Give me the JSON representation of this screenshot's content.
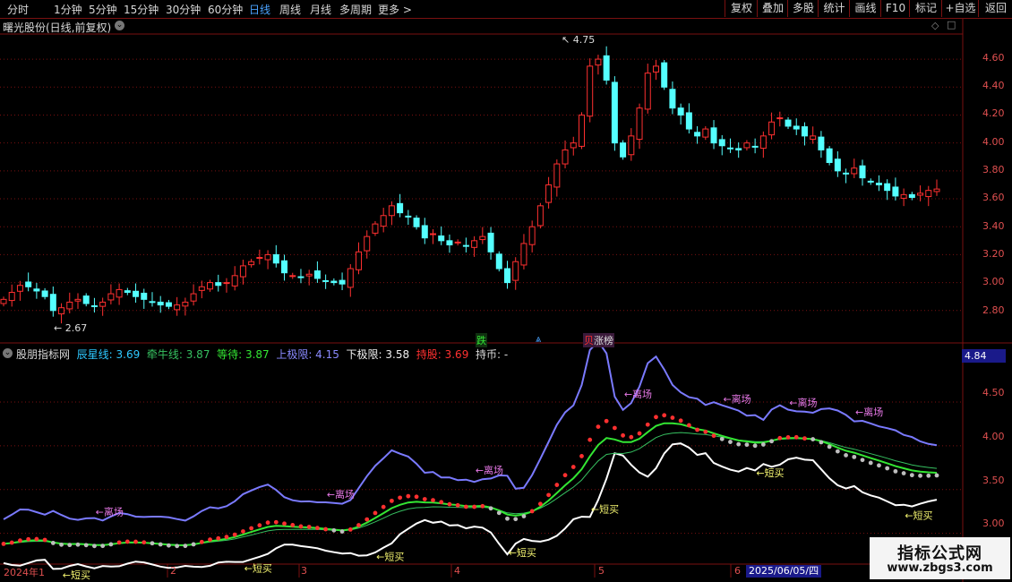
{
  "toolbar": {
    "periods": [
      "分时",
      "1分钟",
      "5分钟",
      "15分钟",
      "30分钟",
      "60分钟",
      "日线",
      "周线",
      "月线",
      "多周期",
      "更多 >"
    ],
    "active_period": "日线",
    "right_buttons": [
      "复权",
      "叠加",
      "多股",
      "统计",
      "画线",
      "F10",
      "标记",
      "+自选",
      "返回"
    ]
  },
  "stock": {
    "title": "曙光股份(日线,前复权)",
    "high_label": "4.75",
    "low_label": "2.67",
    "price_axis": [
      "4.60",
      "4.40",
      "4.20",
      "4.00",
      "3.80",
      "3.60",
      "3.40",
      "3.20",
      "3.00",
      "2.80"
    ]
  },
  "markers": {
    "m1": "跌",
    "m2": "涨榜"
  },
  "indicator": {
    "name": "股朋指标网",
    "items": [
      {
        "label": "辰星线: 3.69",
        "color": "#2ec8ff"
      },
      {
        "label": "牵牛线: 3.87",
        "color": "#36c060"
      },
      {
        "label": "等待: 3.87",
        "color": "#33e633"
      },
      {
        "label": "上极限: 4.15",
        "color": "#8a8aff"
      },
      {
        "label": "下极限: 3.58",
        "color": "#f0f0f0"
      },
      {
        "label": "持股: 3.69",
        "color": "#ff3030"
      },
      {
        "label": "持币: -",
        "color": "#d8d8d8"
      }
    ],
    "axis": [
      "4.50",
      "4.00",
      "3.50",
      "3.00"
    ],
    "axis_box": "4.84",
    "sell_label": "←离场",
    "buy_label": "←短买",
    "sell_label_short": "离场",
    "buy_label_short": "短买"
  },
  "dates": {
    "labels": [
      "2024年1",
      "2",
      "3",
      "4",
      "5",
      "6"
    ],
    "current": "2025/06/05/四"
  },
  "watermark": {
    "title": "指标公式网",
    "url": "www.zbgs3.com"
  },
  "colors": {
    "up": "#ff3030",
    "down": "#54ffff",
    "upper": "#7a7aff",
    "lower": "#ffffff",
    "wait": "#33e633",
    "slow": "#36c060",
    "grid": "#7a1010"
  },
  "chart_data": {
    "type": "candlestick",
    "ylim": [
      2.6,
      4.78
    ],
    "indicator_ylim": [
      2.7,
      4.95
    ],
    "price_axis_ticks": [
      4.6,
      4.4,
      4.2,
      4.0,
      3.8,
      3.6,
      3.4,
      3.2,
      3.0,
      2.8
    ],
    "indicator_axis_ticks": [
      4.5,
      4.0,
      3.5,
      3.0
    ],
    "high": 4.75,
    "low": 2.67,
    "indicator_last": {
      "辰星线": 3.69,
      "牵牛线": 3.87,
      "等待": 3.87,
      "上极限": 4.15,
      "下极限": 3.58,
      "持股": 3.69
    },
    "close_series": [
      2.88,
      2.93,
      2.98,
      2.97,
      2.94,
      2.9,
      2.8,
      2.82,
      2.86,
      2.88,
      2.85,
      2.83,
      2.86,
      2.92,
      2.95,
      2.93,
      2.9,
      2.88,
      2.86,
      2.84,
      2.83,
      2.84,
      2.86,
      2.92,
      2.97,
      3.0,
      2.98,
      3.0,
      3.05,
      3.12,
      3.15,
      3.18,
      3.2,
      3.14,
      3.07,
      3.05,
      3.04,
      3.06,
      3.03,
      3.01,
      3.0,
      2.99,
      3.1,
      3.22,
      3.33,
      3.42,
      3.48,
      3.55,
      3.5,
      3.47,
      3.4,
      3.32,
      3.35,
      3.3,
      3.27,
      3.29,
      3.26,
      3.3,
      3.33,
      3.22,
      3.1,
      3.0,
      3.15,
      3.28,
      3.4,
      3.55,
      3.7,
      3.85,
      3.95,
      4.0,
      4.2,
      4.55,
      4.6,
      4.45,
      4.0,
      3.9,
      4.05,
      4.25,
      4.5,
      4.55,
      4.4,
      4.25,
      4.2,
      4.1,
      4.05,
      4.1,
      4.0,
      3.98,
      3.96,
      3.95,
      4.0,
      3.97,
      4.05,
      4.15,
      4.18,
      4.12,
      4.1,
      4.05,
      4.05,
      3.95,
      3.86,
      3.8,
      3.78,
      3.82,
      3.75,
      3.72,
      3.7,
      3.66,
      3.62,
      3.63,
      3.61,
      3.64,
      3.66,
      3.67
    ]
  }
}
